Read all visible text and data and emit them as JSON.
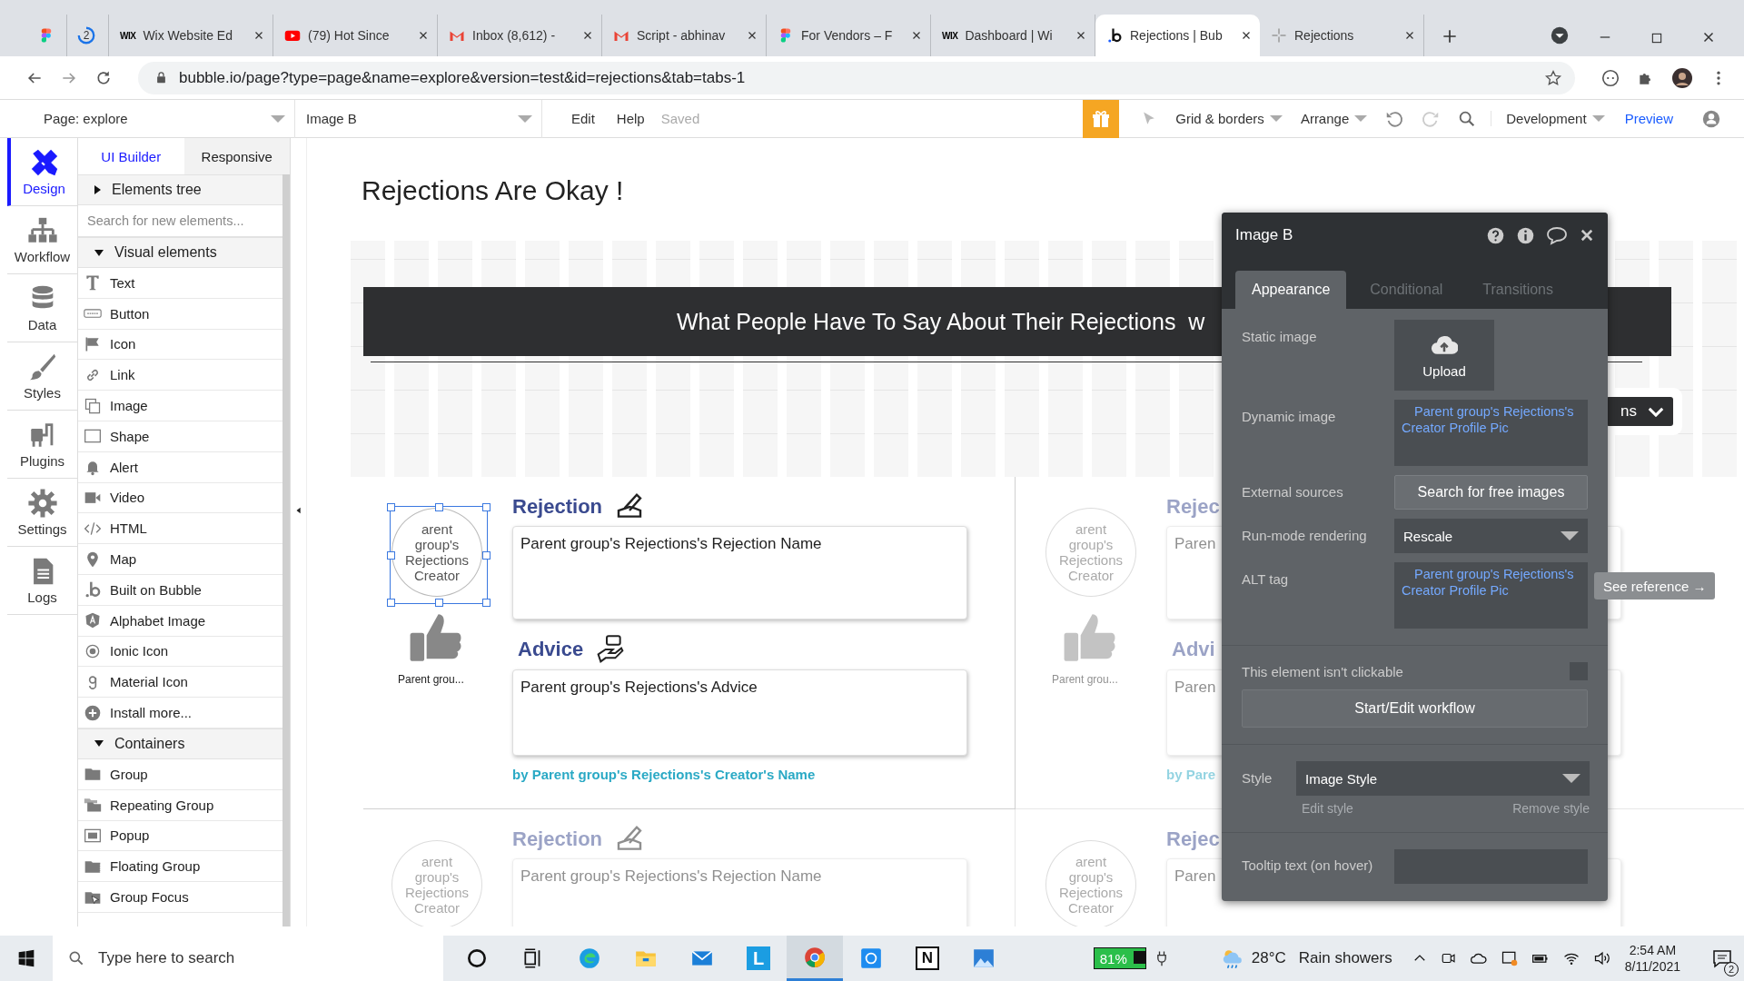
{
  "browser": {
    "tabs": [
      {
        "kind": "figma",
        "selected": false
      },
      {
        "kind": "spinner",
        "badge": "2",
        "selected": false
      },
      {
        "kind": "wix",
        "favicon_text": "WIX",
        "title": "Wix Website Ed",
        "selected": false
      },
      {
        "kind": "youtube",
        "title": "(79) Hot Since",
        "selected": false
      },
      {
        "kind": "gmail",
        "title": "Inbox (8,612) -",
        "selected": false
      },
      {
        "kind": "gmail",
        "title": "Script - abhinav",
        "selected": false
      },
      {
        "kind": "figma",
        "title": "For Vendors – F",
        "selected": false
      },
      {
        "kind": "wix",
        "favicon_text": "WIX",
        "title": "Dashboard | Wi",
        "selected": false
      },
      {
        "kind": "bubble",
        "title": "Rejections | Bub",
        "selected": true
      },
      {
        "kind": "page",
        "title": "Rejections",
        "selected": false
      }
    ],
    "url": "bubble.io/page?type=page&name=explore&version=test&id=rejections&tab=tabs-1"
  },
  "toolbar": {
    "page_select": "Page: explore",
    "element_select": "Image B",
    "menus": [
      "Edit",
      "Help"
    ],
    "save_status": "Saved",
    "grid_menu": "Grid & borders",
    "arrange_menu": "Arrange",
    "version_select": "Development",
    "preview": "Preview"
  },
  "sidebar": {
    "items": [
      {
        "label": "Design",
        "selected": true
      },
      {
        "label": "Workflow",
        "selected": false
      },
      {
        "label": "Data",
        "selected": false
      },
      {
        "label": "Styles",
        "selected": false
      },
      {
        "label": "Plugins",
        "selected": false
      },
      {
        "label": "Settings",
        "selected": false
      },
      {
        "label": "Logs",
        "selected": false
      }
    ]
  },
  "element_panel": {
    "tabs": [
      {
        "label": "UI Builder",
        "selected": true
      },
      {
        "label": "Responsive",
        "selected": false
      }
    ],
    "elements_tree": {
      "title": "Elements tree",
      "expanded": false
    },
    "search": {
      "placeholder": "Search for new elements..."
    },
    "groups": [
      {
        "title": "Visual elements",
        "expanded": true,
        "items": [
          {
            "label": "Text"
          },
          {
            "label": "Button"
          },
          {
            "label": "Icon"
          },
          {
            "label": "Link"
          },
          {
            "label": "Image"
          },
          {
            "label": "Shape"
          },
          {
            "label": "Alert"
          },
          {
            "label": "Video"
          },
          {
            "label": "HTML"
          },
          {
            "label": "Map"
          },
          {
            "label": "Built on Bubble"
          },
          {
            "label": "Alphabet Image"
          },
          {
            "label": "Ionic Icon"
          },
          {
            "label": "Material Icon"
          },
          {
            "label": "Install more..."
          }
        ]
      },
      {
        "title": "Containers",
        "expanded": true,
        "items": [
          {
            "label": "Group"
          },
          {
            "label": "Repeating Group"
          },
          {
            "label": "Popup"
          },
          {
            "label": "Floating Group"
          },
          {
            "label": "Group Focus"
          }
        ]
      }
    ]
  },
  "canvas": {
    "page_title": "Rejections Are Okay !",
    "banner": "What People Have To Say About Their Rejections  w",
    "dropdown": "ns",
    "cells": [
      {
        "dimmed": false,
        "image_text": "arent group's Rejections Creator",
        "image_selected": true,
        "caption": "Parent grou...",
        "heading": "Rejection",
        "heading_icon": true,
        "card_text": "Parent group's Rejections's Rejection Name",
        "advice_heading": "Advice",
        "advice_icon": true,
        "advice_text": "Parent group's Rejections's Advice",
        "byline": "by Parent group's Rejections's Creator's Name"
      },
      {
        "dimmed": true,
        "image_text": "arent group's Rejections Creator",
        "image_selected": false,
        "caption": "Parent grou...",
        "heading": "Rejec",
        "card_text": "Paren",
        "advice_heading": "Advi",
        "advice_text": "Paren",
        "byline": "by Pare"
      },
      {
        "dimmed": true,
        "image_text": "arent group's Rejections Creator",
        "image_selected": false,
        "heading": "Rejection",
        "heading_icon": true,
        "card_text": "Parent group's Rejections's Rejection Name"
      },
      {
        "dimmed": true,
        "image_text": "arent group's Rejections Creator",
        "image_selected": false,
        "heading": "Rejec",
        "card_text": "Paren"
      }
    ]
  },
  "property_editor": {
    "title": "Image B",
    "tabs": [
      {
        "label": "Appearance",
        "selected": true
      },
      {
        "label": "Conditional",
        "selected": false
      },
      {
        "label": "Transitions",
        "selected": false
      }
    ],
    "rows": [
      {
        "kind": "upload",
        "label": "Static image",
        "button": "Upload"
      },
      {
        "kind": "expression",
        "label": "Dynamic image",
        "value": "Parent group's Rejections's Creator Profile Pic"
      },
      {
        "kind": "button",
        "label": "External sources",
        "button": "Search for free images"
      },
      {
        "kind": "dropdown",
        "label": "Run-mode rendering",
        "value": "Rescale"
      },
      {
        "kind": "expression",
        "label": "ALT tag",
        "value": "Parent group's Rejections's Creator Profile Pic"
      },
      {
        "kind": "checkbox",
        "label": "This element isn't clickable",
        "checked": false
      },
      {
        "kind": "wide-button",
        "button": "Start/Edit workflow"
      },
      {
        "kind": "style",
        "label": "Style",
        "value": "Image Style",
        "links": [
          "Edit style",
          "Remove style"
        ]
      },
      {
        "kind": "text-input",
        "label": "Tooltip text (on hover)"
      }
    ]
  },
  "tooltip": "See reference →",
  "taskbar": {
    "search_placeholder": "Type here to search",
    "apps": [
      {
        "kind": "cortana",
        "active": false
      },
      {
        "kind": "task-view",
        "active": false
      },
      {
        "kind": "edge",
        "active": false
      },
      {
        "kind": "explorer",
        "active": false
      },
      {
        "kind": "mail",
        "active": false
      },
      {
        "kind": "letter",
        "letter": "L",
        "active": false
      },
      {
        "kind": "chrome",
        "active": true
      },
      {
        "kind": "blue-app",
        "active": false
      },
      {
        "kind": "letter",
        "letter": "N",
        "active": false
      },
      {
        "kind": "photos",
        "active": false
      }
    ],
    "battery": "81%",
    "temperature": "28°C",
    "weather": "Rain showers",
    "time": "2:54 AM",
    "date": "8/11/2021",
    "notifications": "2"
  }
}
